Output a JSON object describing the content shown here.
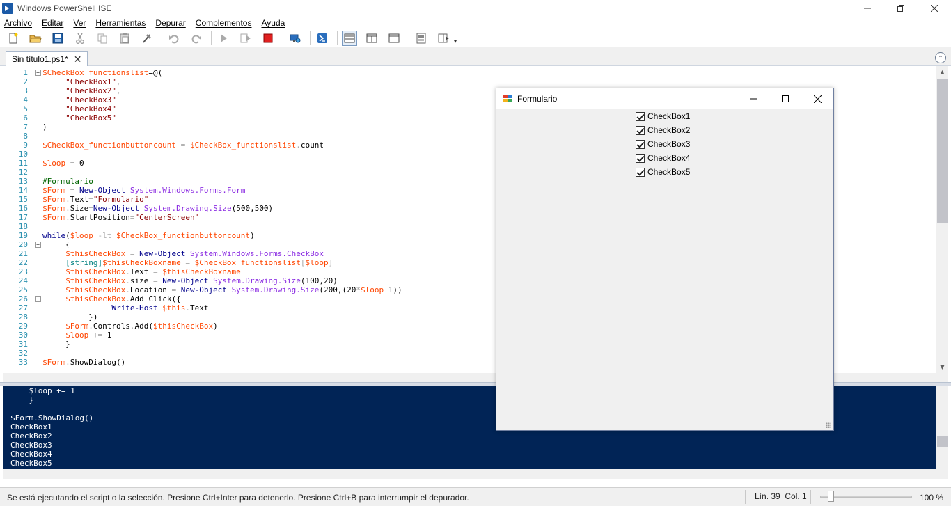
{
  "window": {
    "title": "Windows PowerShell ISE"
  },
  "menu": [
    "Archivo",
    "Editar",
    "Ver",
    "Herramientas",
    "Depurar",
    "Complementos",
    "Ayuda"
  ],
  "toolbar": [
    {
      "name": "new-script-icon"
    },
    {
      "name": "open-icon"
    },
    {
      "name": "save-icon"
    },
    {
      "name": "cut-icon"
    },
    {
      "name": "copy-icon"
    },
    {
      "name": "paste-icon"
    },
    {
      "name": "clear-console-icon"
    },
    {
      "name": "undo-icon"
    },
    {
      "name": "redo-icon"
    },
    {
      "name": "run-script-icon"
    },
    {
      "name": "run-selection-icon"
    },
    {
      "name": "stop-icon"
    },
    {
      "name": "new-remote-tab-icon"
    },
    {
      "name": "powershell-icon"
    },
    {
      "name": "show-script-top-icon"
    },
    {
      "name": "show-script-right-icon"
    },
    {
      "name": "show-script-max-icon"
    },
    {
      "name": "show-commands-icon"
    },
    {
      "name": "show-addon-icon"
    }
  ],
  "tab": {
    "label": "Sin título1.ps1*"
  },
  "editor": {
    "lines": [
      {
        "n": "1",
        "fold": "−",
        "seg": [
          [
            "v",
            "$CheckBox_functionslist"
          ],
          [
            "p",
            "=@("
          ]
        ]
      },
      {
        "n": "2",
        "seg": [
          [
            "p",
            "     "
          ],
          [
            "s",
            "\"CheckBox1\""
          ],
          [
            "o",
            ","
          ]
        ]
      },
      {
        "n": "3",
        "seg": [
          [
            "p",
            "     "
          ],
          [
            "s",
            "\"CheckBox2\""
          ],
          [
            "o",
            ","
          ]
        ]
      },
      {
        "n": "4",
        "seg": [
          [
            "p",
            "     "
          ],
          [
            "s",
            "\"CheckBox3\""
          ]
        ]
      },
      {
        "n": "5",
        "seg": [
          [
            "p",
            "     "
          ],
          [
            "s",
            "\"CheckBox4\""
          ]
        ]
      },
      {
        "n": "6",
        "seg": [
          [
            "p",
            "     "
          ],
          [
            "s",
            "\"CheckBox5\""
          ]
        ]
      },
      {
        "n": "7",
        "seg": [
          [
            "p",
            ")"
          ]
        ]
      },
      {
        "n": "8",
        "seg": []
      },
      {
        "n": "9",
        "seg": [
          [
            "v",
            "$CheckBox_functionbuttoncount"
          ],
          [
            "o",
            " = "
          ],
          [
            "v",
            "$CheckBox_functionslist"
          ],
          [
            "o",
            "."
          ],
          [
            "p",
            "count"
          ]
        ]
      },
      {
        "n": "10",
        "seg": []
      },
      {
        "n": "11",
        "seg": [
          [
            "v",
            "$loop"
          ],
          [
            "o",
            " = "
          ],
          [
            "p",
            "0"
          ]
        ]
      },
      {
        "n": "12",
        "seg": []
      },
      {
        "n": "13",
        "seg": [
          [
            "c",
            "#Formulario"
          ]
        ]
      },
      {
        "n": "14",
        "seg": [
          [
            "v",
            "$Form"
          ],
          [
            "o",
            " = "
          ],
          [
            "k",
            "New-Object"
          ],
          [
            "p",
            " "
          ],
          [
            "t",
            "System.Windows.Forms.Form"
          ]
        ]
      },
      {
        "n": "15",
        "seg": [
          [
            "v",
            "$Form"
          ],
          [
            "o",
            "."
          ],
          [
            "p",
            "Text"
          ],
          [
            "o",
            "="
          ],
          [
            "s",
            "\"Formulario\""
          ]
        ]
      },
      {
        "n": "16",
        "seg": [
          [
            "v",
            "$Form"
          ],
          [
            "o",
            "."
          ],
          [
            "p",
            "Size"
          ],
          [
            "o",
            "="
          ],
          [
            "k",
            "New-Object"
          ],
          [
            "p",
            " "
          ],
          [
            "t",
            "System.Drawing.Size"
          ],
          [
            "p",
            "(500,500)"
          ]
        ]
      },
      {
        "n": "17",
        "seg": [
          [
            "v",
            "$Form"
          ],
          [
            "o",
            "."
          ],
          [
            "p",
            "StartPosition"
          ],
          [
            "o",
            "="
          ],
          [
            "s",
            "\"CenterScreen\""
          ]
        ]
      },
      {
        "n": "18",
        "seg": []
      },
      {
        "n": "19",
        "seg": [
          [
            "k",
            "while"
          ],
          [
            "p",
            "("
          ],
          [
            "v",
            "$loop"
          ],
          [
            "o",
            " -lt "
          ],
          [
            "v",
            "$CheckBox_functionbuttoncount"
          ],
          [
            "p",
            ")"
          ]
        ]
      },
      {
        "n": "20",
        "fold": "−",
        "seg": [
          [
            "p",
            "     {"
          ]
        ]
      },
      {
        "n": "21",
        "seg": [
          [
            "p",
            "     "
          ],
          [
            "v",
            "$thisCheckBox"
          ],
          [
            "o",
            " = "
          ],
          [
            "k",
            "New-Object"
          ],
          [
            "p",
            " "
          ],
          [
            "t",
            "System.Windows.Forms.CheckBox"
          ]
        ]
      },
      {
        "n": "22",
        "seg": [
          [
            "p",
            "     "
          ],
          [
            "ty",
            "[string]"
          ],
          [
            "v",
            "$thisCheckBoxname"
          ],
          [
            "o",
            " = "
          ],
          [
            "v",
            "$CheckBox_functionslist"
          ],
          [
            "o",
            "["
          ],
          [
            "v",
            "$loop"
          ],
          [
            "o",
            "]"
          ]
        ]
      },
      {
        "n": "23",
        "seg": [
          [
            "p",
            "     "
          ],
          [
            "v",
            "$thisCheckBox"
          ],
          [
            "o",
            "."
          ],
          [
            "p",
            "Text"
          ],
          [
            "o",
            " = "
          ],
          [
            "v",
            "$thisCheckBoxname"
          ]
        ]
      },
      {
        "n": "24",
        "seg": [
          [
            "p",
            "     "
          ],
          [
            "v",
            "$thisCheckBox"
          ],
          [
            "o",
            "."
          ],
          [
            "p",
            "size"
          ],
          [
            "o",
            " = "
          ],
          [
            "k",
            "New-Object"
          ],
          [
            "p",
            " "
          ],
          [
            "t",
            "System.Drawing.Size"
          ],
          [
            "p",
            "(100,20)"
          ]
        ]
      },
      {
        "n": "25",
        "seg": [
          [
            "p",
            "     "
          ],
          [
            "v",
            "$thisCheckBox"
          ],
          [
            "o",
            "."
          ],
          [
            "p",
            "Location"
          ],
          [
            "o",
            " = "
          ],
          [
            "k",
            "New-Object"
          ],
          [
            "p",
            " "
          ],
          [
            "t",
            "System.Drawing.Size"
          ],
          [
            "p",
            "(200,(20"
          ],
          [
            "o",
            "*"
          ],
          [
            "v",
            "$loop"
          ],
          [
            "o",
            "+"
          ],
          [
            "p",
            "1))"
          ]
        ]
      },
      {
        "n": "26",
        "fold": "−",
        "seg": [
          [
            "p",
            "     "
          ],
          [
            "v",
            "$thisCheckBox"
          ],
          [
            "o",
            "."
          ],
          [
            "p",
            "Add_Click({"
          ]
        ]
      },
      {
        "n": "27",
        "seg": [
          [
            "p",
            "               "
          ],
          [
            "k",
            "Write-Host"
          ],
          [
            "p",
            " "
          ],
          [
            "v",
            "$this"
          ],
          [
            "o",
            "."
          ],
          [
            "p",
            "Text"
          ]
        ]
      },
      {
        "n": "28",
        "seg": [
          [
            "p",
            "          })"
          ]
        ]
      },
      {
        "n": "29",
        "seg": [
          [
            "p",
            "     "
          ],
          [
            "v",
            "$Form"
          ],
          [
            "o",
            "."
          ],
          [
            "p",
            "Controls"
          ],
          [
            "o",
            "."
          ],
          [
            "p",
            "Add("
          ],
          [
            "v",
            "$thisCheckBox"
          ],
          [
            "p",
            ")"
          ]
        ]
      },
      {
        "n": "30",
        "seg": [
          [
            "p",
            "     "
          ],
          [
            "v",
            "$loop"
          ],
          [
            "o",
            " += "
          ],
          [
            "p",
            "1"
          ]
        ]
      },
      {
        "n": "31",
        "seg": [
          [
            "p",
            "     }"
          ]
        ]
      },
      {
        "n": "32",
        "seg": []
      },
      {
        "n": "33",
        "seg": [
          [
            "v",
            "$Form"
          ],
          [
            "o",
            "."
          ],
          [
            "p",
            "ShowDialog()"
          ]
        ]
      }
    ]
  },
  "console": {
    "lines": [
      "    $loop += 1",
      "    }",
      "",
      "$Form.ShowDialog()",
      "CheckBox1",
      "CheckBox2",
      "CheckBox3",
      "CheckBox4",
      "CheckBox5"
    ]
  },
  "status": {
    "message": "Se está ejecutando el script o la selección. Presione Ctrl+Inter para detenerlo. Presione Ctrl+B para interrumpir el depurador.",
    "position": "Lín. 39  Col. 1",
    "zoom": "100 %",
    "zoom_level": 0.35
  },
  "form": {
    "title": "Formulario",
    "checkboxes": [
      {
        "label": "CheckBox1",
        "checked": true
      },
      {
        "label": "CheckBox2",
        "checked": true
      },
      {
        "label": "CheckBox3",
        "checked": true
      },
      {
        "label": "CheckBox4",
        "checked": true
      },
      {
        "label": "CheckBox5",
        "checked": true
      }
    ]
  },
  "colors": {
    "console_bg": "#012456",
    "variable": "#ff4500",
    "string": "#8b0000",
    "keyword": "#00008b",
    "comment": "#006400",
    "type": "#8a2be2",
    "line_number": "#2b91af"
  }
}
